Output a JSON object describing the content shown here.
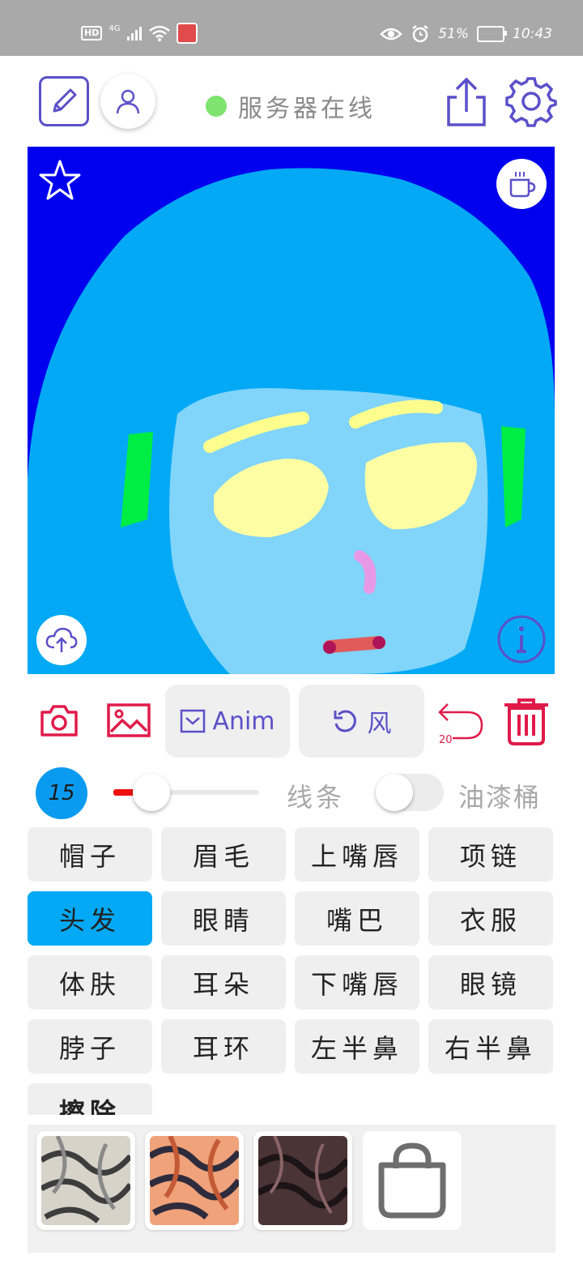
{
  "status_bar": {
    "hd": "HD",
    "network": "4G",
    "battery_percent": "51%",
    "time": "10:43"
  },
  "header": {
    "server_status": "服务器在线",
    "status_color": "#7ee36f"
  },
  "canvas": {
    "background_color": "#0000ee"
  },
  "actions": {
    "anim_label": "Anim",
    "wind_label": "风",
    "undo_count": "20"
  },
  "brush": {
    "size": "15",
    "size_fraction": 0.18,
    "line_label": "线条",
    "bucket_label": "油漆桶",
    "bucket_enabled": false
  },
  "parts": [
    {
      "label": "帽子",
      "selected": false
    },
    {
      "label": "眉毛",
      "selected": false
    },
    {
      "label": "上嘴唇",
      "selected": false
    },
    {
      "label": "项链",
      "selected": false
    },
    {
      "label": "头发",
      "selected": true
    },
    {
      "label": "眼睛",
      "selected": false
    },
    {
      "label": "嘴巴",
      "selected": false
    },
    {
      "label": "衣服",
      "selected": false
    },
    {
      "label": "体肤",
      "selected": false
    },
    {
      "label": "耳朵",
      "selected": false
    },
    {
      "label": "下嘴唇",
      "selected": false
    },
    {
      "label": "眼镜",
      "selected": false
    },
    {
      "label": "脖子",
      "selected": false
    },
    {
      "label": "耳环",
      "selected": false
    },
    {
      "label": "左半鼻",
      "selected": false
    },
    {
      "label": "右半鼻",
      "selected": false
    },
    {
      "label": "擦除",
      "selected": false
    }
  ],
  "textures": [
    {
      "name": "silver-texture"
    },
    {
      "name": "orange-texture"
    },
    {
      "name": "dark-texture"
    }
  ],
  "colors": {
    "accent_purple": "#5b50c9",
    "accent_red": "#e01b4a",
    "selected_blue": "#03a9f4"
  }
}
